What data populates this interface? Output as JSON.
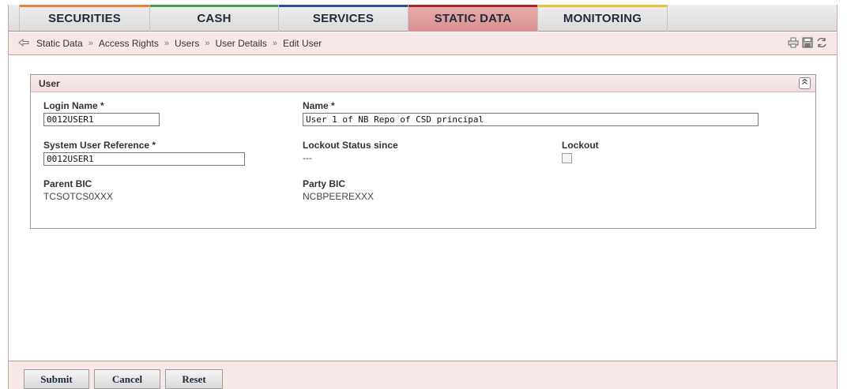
{
  "tabs": [
    {
      "label": "SECURITIES",
      "color": "#e8823a",
      "active": false
    },
    {
      "label": "CASH",
      "color": "#4e9a4e",
      "active": false
    },
    {
      "label": "SERVICES",
      "color": "#2d4aa0",
      "active": false
    },
    {
      "label": "STATIC DATA",
      "color": "#a02828",
      "active": true
    },
    {
      "label": "MONITORING",
      "color": "#e8c23a",
      "active": false
    }
  ],
  "breadcrumb": {
    "items": [
      "Static Data",
      "Access Rights",
      "Users",
      "User Details",
      "Edit User"
    ],
    "separator": "»"
  },
  "toolbar_icons": [
    "print-icon",
    "save-icon",
    "refresh-icon"
  ],
  "panel": {
    "title": "User",
    "fields": {
      "login_name": {
        "label": "Login Name *",
        "value": "0012USER1"
      },
      "name": {
        "label": "Name *",
        "value": "User 1 of NB Repo of CSD principal"
      },
      "system_user_reference": {
        "label": "System User Reference *",
        "value": "0012USER1"
      },
      "lockout_status_since": {
        "label": "Lockout Status since",
        "value": "---"
      },
      "lockout": {
        "label": "Lockout",
        "checked": false
      },
      "parent_bic": {
        "label": "Parent BIC",
        "value": "TCSOTCS0XXX"
      },
      "party_bic": {
        "label": "Party BIC",
        "value": "NCBPEEREXXX"
      }
    }
  },
  "buttons": {
    "submit": "Submit",
    "cancel": "Cancel",
    "reset": "Reset"
  }
}
